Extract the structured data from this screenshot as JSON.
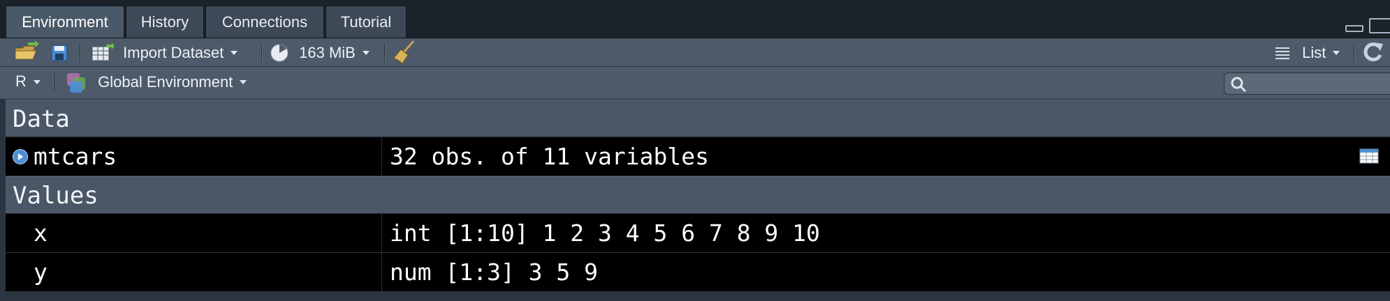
{
  "tabs": [
    {
      "label": "Environment",
      "active": true
    },
    {
      "label": "History",
      "active": false
    },
    {
      "label": "Connections",
      "active": false
    },
    {
      "label": "Tutorial",
      "active": false
    }
  ],
  "toolbar": {
    "import_dataset_label": "Import Dataset",
    "memory_label": "163 MiB",
    "view_mode_label": "List"
  },
  "toolbar2": {
    "language_label": "R",
    "environment_label": "Global Environment"
  },
  "search": {
    "placeholder": ""
  },
  "environment": {
    "data_header": "Data",
    "data_rows": [
      {
        "name": "mtcars",
        "value": "32 obs. of 11 variables"
      }
    ],
    "values_header": "Values",
    "value_rows": [
      {
        "name": "x",
        "value": "int [1:10] 1 2 3 4 5 6 7 8 9 10"
      },
      {
        "name": "y",
        "value": "num [1:3] 3 5 9"
      }
    ]
  },
  "colors": {
    "pane_bg": "#2b3541",
    "toolbar_bg": "#4c5a69",
    "section_bg": "#4a5767",
    "row_bg": "#000000",
    "accent_blue": "#4f8fd6"
  }
}
